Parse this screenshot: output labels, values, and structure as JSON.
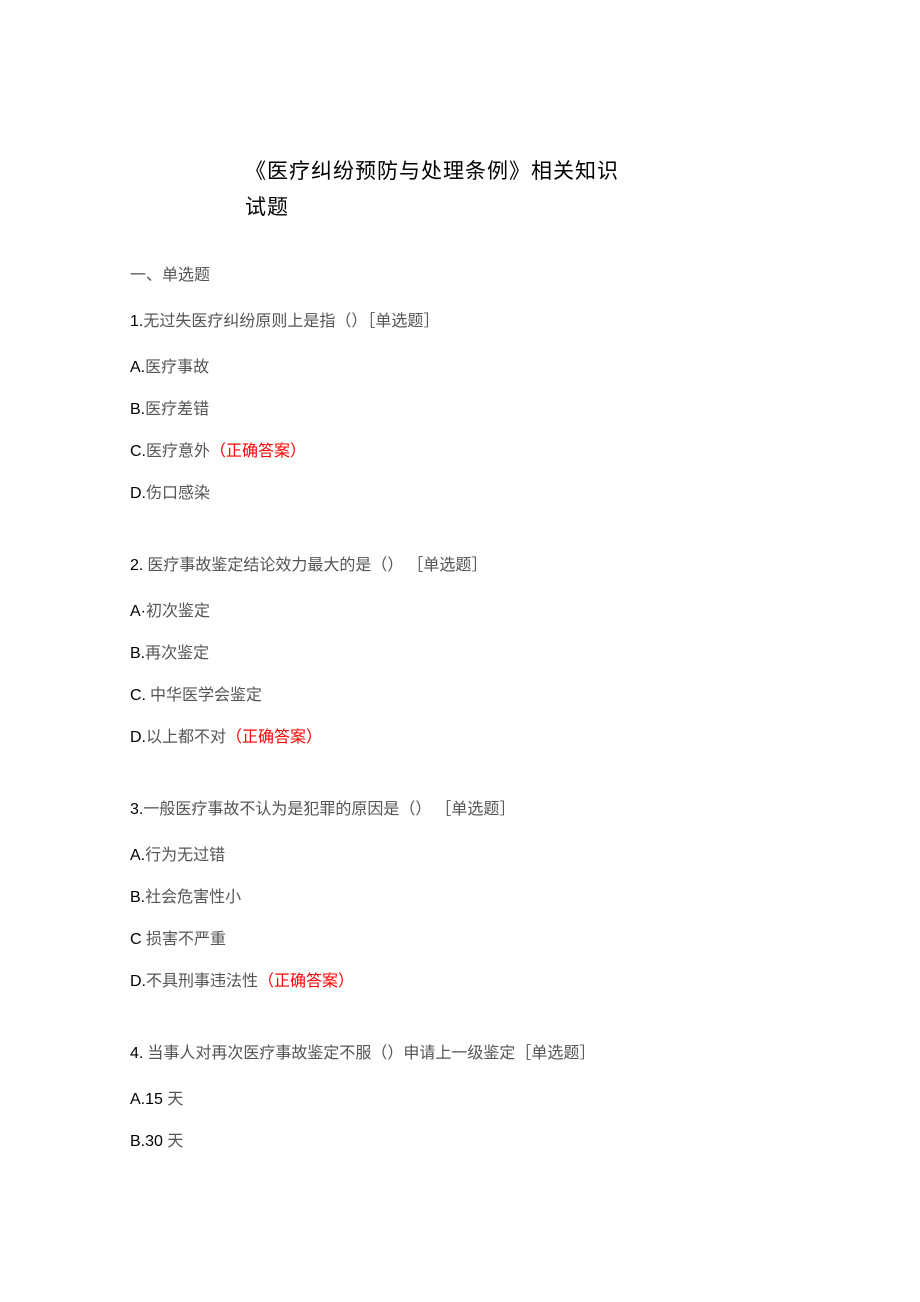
{
  "title": {
    "line1": "《医疗纠纷预防与处理条例》相关知识",
    "line2": "试题"
  },
  "section_header": "一、单选题",
  "correct_label": "（正确答案）",
  "tag_single": "［单选题］",
  "questions": [
    {
      "num": "1.",
      "stem": "无过失医疗纠纷原则上是指（）",
      "options": [
        {
          "letter": "A.",
          "text": "医疗事故",
          "correct": false
        },
        {
          "letter": "B.",
          "text": "医疗差错",
          "correct": false
        },
        {
          "letter": "C.",
          "text": "医疗意外",
          "correct": true
        },
        {
          "letter": "D.",
          "text": "伤口感染",
          "correct": false
        }
      ]
    },
    {
      "num": "2.",
      "stem_prefix": " 医疗事故鉴定结论效力最大的是（）",
      "options": [
        {
          "letter": "A·",
          "text": "初次鉴定",
          "correct": false
        },
        {
          "letter": "B.",
          "text": "再次鉴定",
          "correct": false
        },
        {
          "letter": "C.",
          "text": " 中华医学会鉴定",
          "correct": false
        },
        {
          "letter": "D.",
          "text": "以上都不对",
          "correct": true
        }
      ]
    },
    {
      "num": "3.",
      "stem": "一般医疗事故不认为是犯罪的原因是（）",
      "options": [
        {
          "letter": "A.",
          "text": "行为无过错",
          "correct": false
        },
        {
          "letter": "B.",
          "text": "社会危害性小",
          "correct": false
        },
        {
          "letter": "C ",
          "text": "损害不严重",
          "correct": false
        },
        {
          "letter": "D.",
          "text": "不具刑事违法性",
          "correct": true
        }
      ]
    },
    {
      "num": "4.",
      "stem_prefix": " 当事人对再次医疗事故鉴定不服（）申请上一级鉴定",
      "options": [
        {
          "letter": "A.",
          "text_arial": "15 ",
          "text": "天",
          "correct": false
        },
        {
          "letter": "B.",
          "text_arial": "30 ",
          "text": "天",
          "correct": false
        }
      ]
    }
  ]
}
